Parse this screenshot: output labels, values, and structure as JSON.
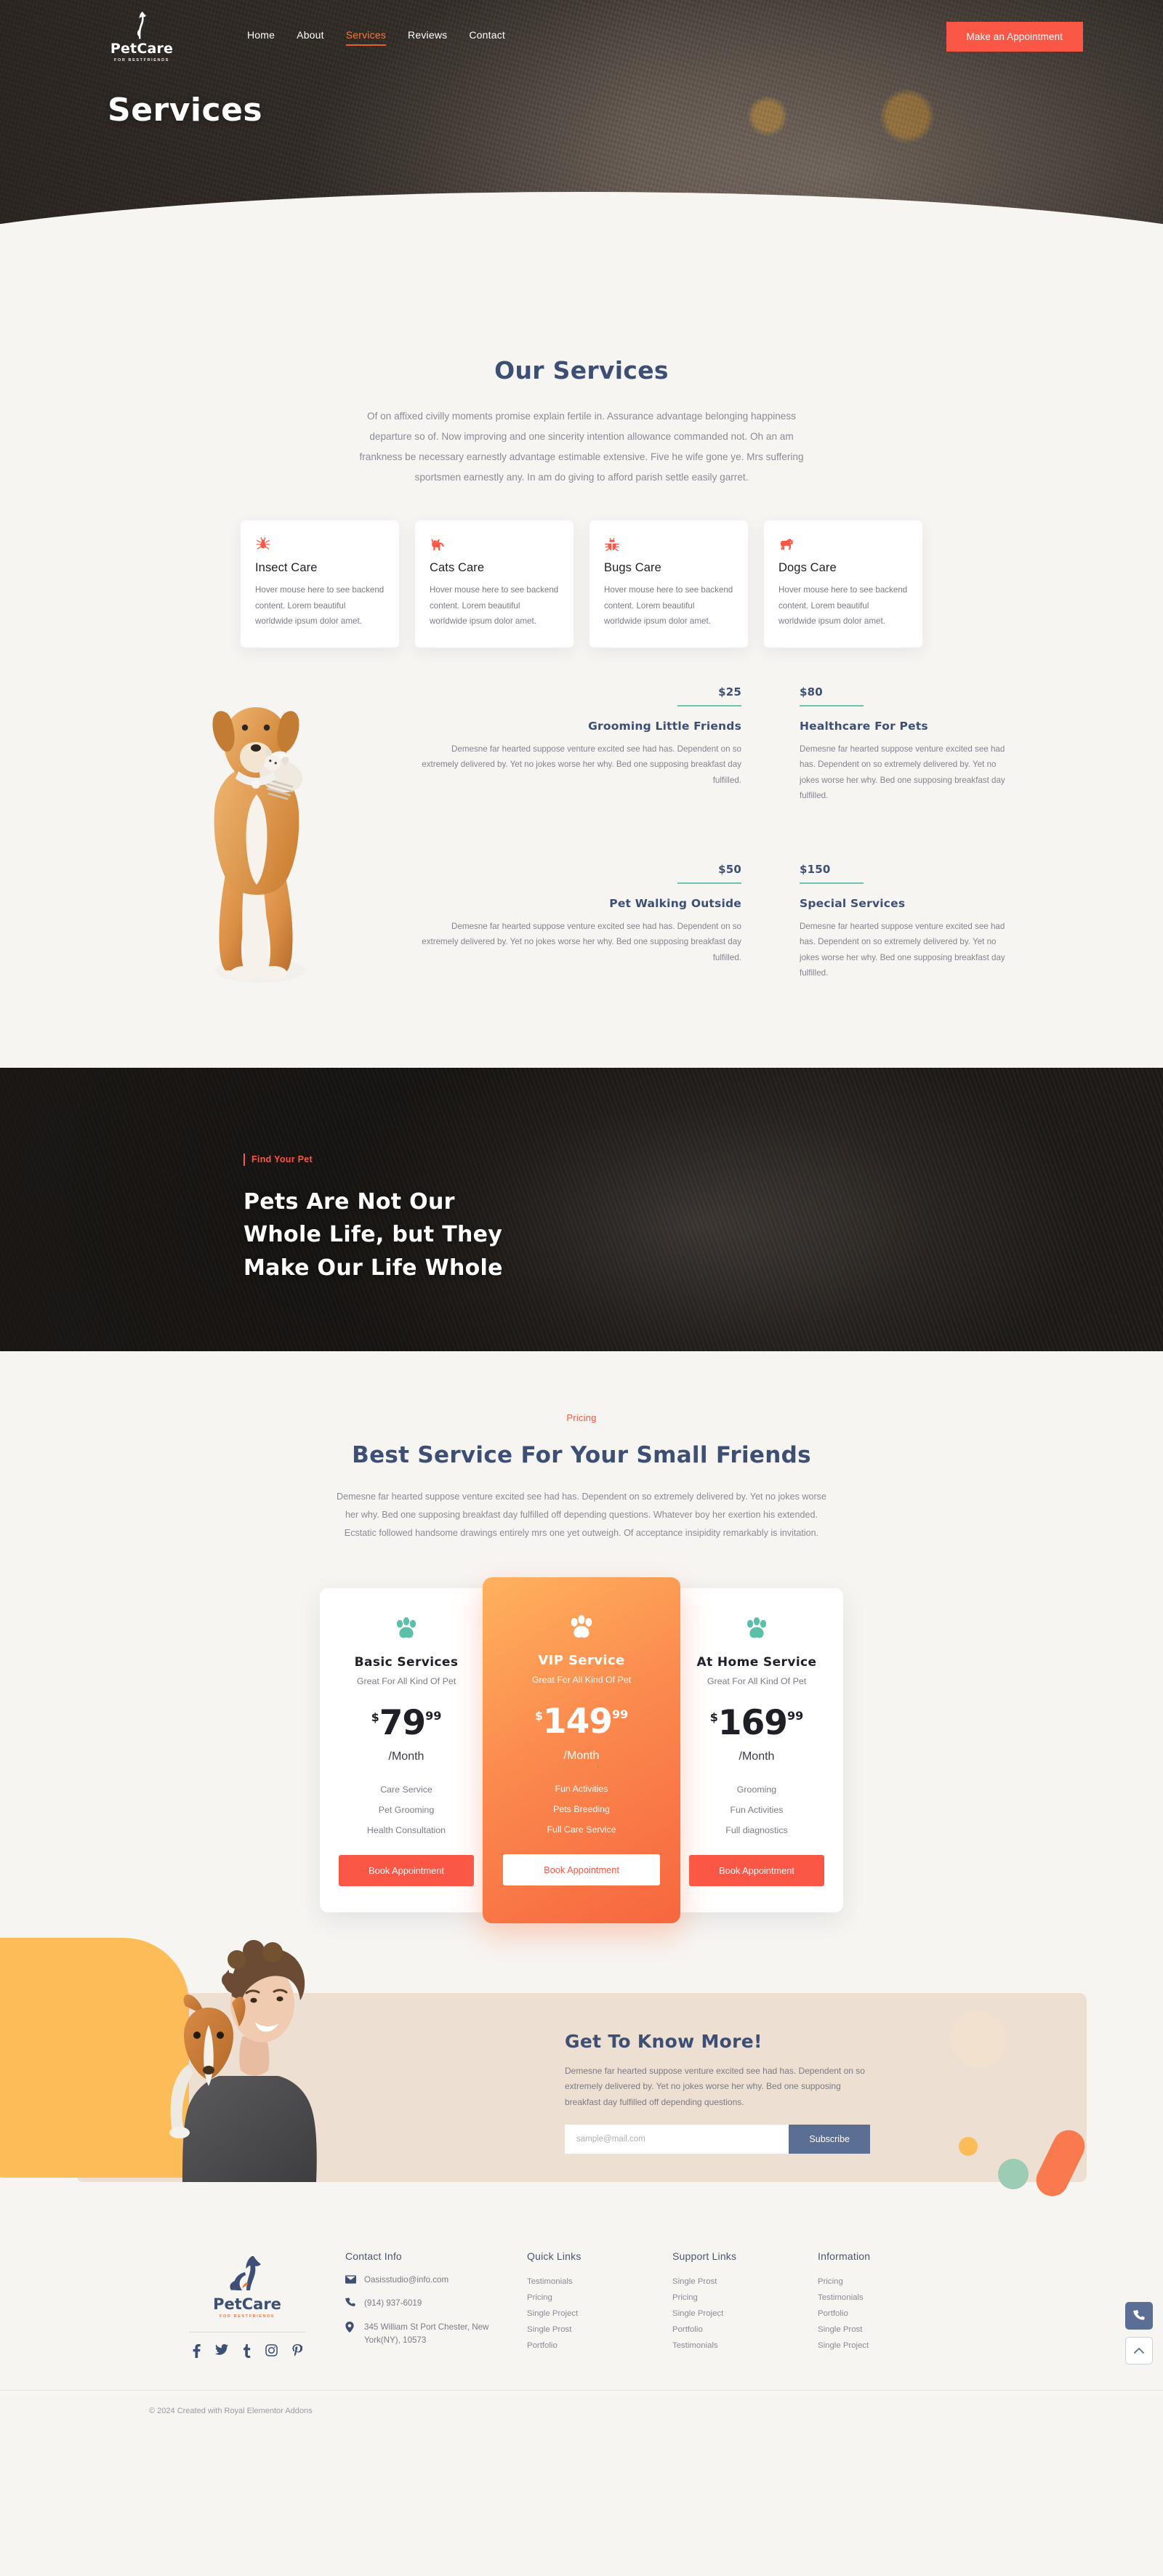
{
  "brand": {
    "name": "PetCare",
    "tagline": "FOR BESTFRIENDS"
  },
  "nav": {
    "items": [
      {
        "label": "Home",
        "active": false
      },
      {
        "label": "About",
        "active": false
      },
      {
        "label": "Services",
        "active": true
      },
      {
        "label": "Reviews",
        "active": false
      },
      {
        "label": "Contact",
        "active": false
      }
    ],
    "cta": "Make an Appointment"
  },
  "hero": {
    "title": "Services"
  },
  "services": {
    "title": "Our Services",
    "description": "Of on affixed civilly moments promise explain fertile in. Assurance advantage belonging happiness departure so of. Now improving and one sincerity intention allowance commanded not. Oh an am frankness be necessary earnestly advantage estimable extensive. Five he wife gone ye. Mrs suffering sportsmen earnestly any. In am do giving to afford parish settle easily garret.",
    "cards": [
      {
        "icon": "spider-icon",
        "name": "Insect Care",
        "text": "Hover mouse here to see backend content. Lorem beautiful worldwide  ipsum dolor amet."
      },
      {
        "icon": "cat-icon",
        "name": "Cats Care",
        "text": "Hover mouse here to see backend content. Lorem beautiful worldwide  ipsum dolor amet."
      },
      {
        "icon": "bug-icon",
        "name": "Bugs Care",
        "text": "Hover mouse here to see backend content. Lorem beautiful worldwide  ipsum dolor amet."
      },
      {
        "icon": "dog-icon",
        "name": "Dogs Care",
        "text": "Hover mouse here to see backend content. Lorem beautiful worldwide  ipsum dolor amet."
      }
    ]
  },
  "features": {
    "accent_color": "#6fc2ae",
    "left": [
      {
        "price": "$25",
        "title": "Grooming Little Friends",
        "text": "Demesne far hearted suppose venture excited see had has. Dependent on so extremely delivered by. Yet no jokes worse her why. Bed one supposing breakfast day fulfilled."
      },
      {
        "price": "$50",
        "title": "Pet Walking Outside",
        "text": "Demesne far hearted suppose venture excited see had has. Dependent on so extremely delivered by. Yet no jokes worse her why. Bed one supposing breakfast day fulfilled."
      }
    ],
    "right": [
      {
        "price": "$80",
        "title": "Healthcare For Pets",
        "text": "Demesne far hearted suppose venture excited see had has. Dependent on so extremely delivered by. Yet no jokes worse her why. Bed one supposing breakfast day fulfilled."
      },
      {
        "price": "$150",
        "title": "Special Services",
        "text": "Demesne far hearted suppose venture excited see had has. Dependent on so extremely delivered by. Yet no jokes worse her why. Bed one supposing breakfast day fulfilled."
      }
    ]
  },
  "quote": {
    "tag": "Find Your Pet",
    "line1": "Pets Are Not Our",
    "line2": "Whole Life, but They",
    "line3": "Make Our Life Whole"
  },
  "pricing": {
    "tag": "Pricing",
    "title": "Best Service For Your Small Friends",
    "description": "Demesne far hearted suppose venture excited see had has. Dependent on so extremely delivered by. Yet no jokes worse her why. Bed one supposing breakfast day fulfilled off depending questions. Whatever boy her exertion his extended. Ecstatic followed handsome drawings entirely mrs one yet outweigh. Of acceptance insipidity remarkably is invitation.",
    "paw_color": "#5cbfa8",
    "plans": [
      {
        "name": "Basic Services",
        "subtitle": "Great For All Kind Of Pet",
        "currency": "$",
        "amount": "79",
        "cents": "99",
        "period": "/Month",
        "features": [
          "Care Service",
          "Pet Grooming",
          "Health Consultation"
        ],
        "cta": "Book Appointment",
        "featured": false
      },
      {
        "name": "VIP Service",
        "subtitle": "Great For All Kind Of Pet",
        "currency": "$",
        "amount": "149",
        "cents": "99",
        "period": "/Month",
        "features": [
          "Fun Activities",
          "Pets Breeding",
          "Full Care Service"
        ],
        "cta": "Book Appointment",
        "featured": true
      },
      {
        "name": "At Home Service",
        "subtitle": "Great For All Kind Of Pet",
        "currency": "$",
        "amount": "169",
        "cents": "99",
        "period": "/Month",
        "features": [
          "Grooming",
          "Fun Activities",
          "Full diagnostics"
        ],
        "cta": "Book Appointment",
        "featured": false
      }
    ]
  },
  "newsletter": {
    "title": "Get To Know More!",
    "text": "Demesne far hearted suppose venture excited see had has. Dependent on so extremely delivered by. Yet no jokes worse her why. Bed one supposing breakfast day fulfilled off depending questions.",
    "placeholder": "sample@mail.com",
    "value": "",
    "button": "Subscribe"
  },
  "footer": {
    "contact": {
      "heading": "Contact Info",
      "email": "Oasisstudio@info.com",
      "phone": "(914) 937-6019",
      "address": "345 William St Port Chester, New York(NY), 10573"
    },
    "social": [
      "facebook-icon",
      "twitter-icon",
      "tumblr-icon",
      "instagram-icon",
      "pinterest-icon"
    ],
    "columns": [
      {
        "heading": "Quick Links",
        "links": [
          "Testimonials",
          "Pricing",
          "Single Project",
          "Single Prost",
          "Portfolio"
        ]
      },
      {
        "heading": "Support Links",
        "links": [
          "Single Prost",
          "Pricing",
          "Single Project",
          "Portfolio",
          "Testimonials"
        ]
      },
      {
        "heading": "Information",
        "links": [
          "Pricing",
          "Testimonials",
          "Portfolio",
          "Single Prost",
          "Single Project"
        ]
      }
    ],
    "copyright": "© 2024 Created with Royal Elementor Addons"
  },
  "floating": {
    "phone": "phone-icon",
    "back_to_top": "chevron-up-icon"
  }
}
